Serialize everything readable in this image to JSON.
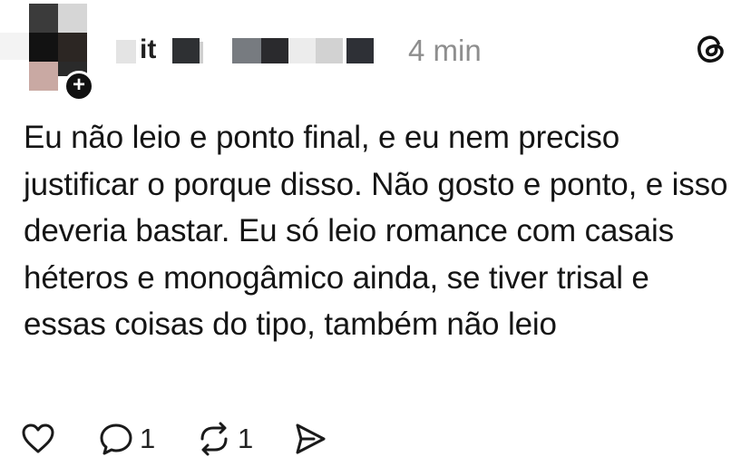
{
  "post": {
    "author": {
      "username_visible": "it",
      "avatar": "pixelated-avatar",
      "follow_badge": "+"
    },
    "timestamp": "4 min",
    "platform_icon": "threads-logo-icon",
    "text": "Eu não leio e ponto final, e eu nem preciso justificar o porque disso. Não gosto e ponto, e isso deveria bastar. Eu só leio romance com casais héteros e monogâmico ainda, se tiver trisal e essas coisas do tipo, também não leio",
    "actions": {
      "like_icon": "heart-icon",
      "reply_icon": "comment-icon",
      "reply_count": "1",
      "repost_icon": "repost-icon",
      "repost_count": "1",
      "share_icon": "send-icon"
    }
  },
  "colors": {
    "background": "#ffffff",
    "text": "#151515",
    "muted": "#8e8e8e"
  }
}
